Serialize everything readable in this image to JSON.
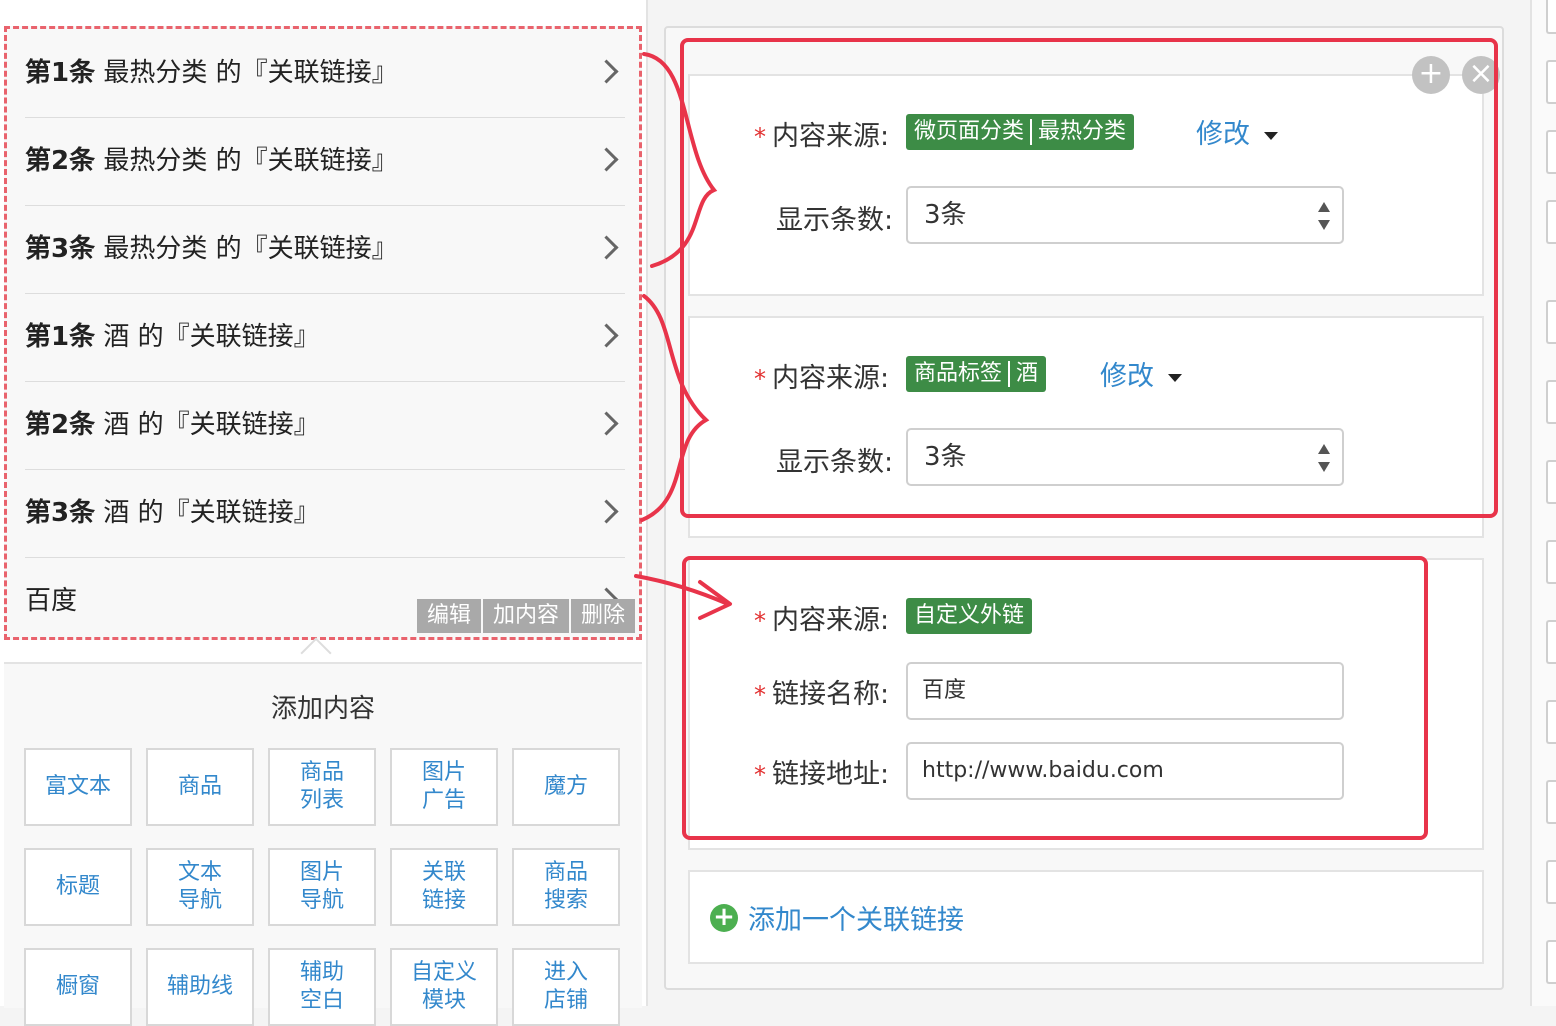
{
  "preview": {
    "rows": [
      {
        "num": "第1条",
        "text": " 最热分类 的『关联链接』"
      },
      {
        "num": "第2条",
        "text": " 最热分类 的『关联链接』"
      },
      {
        "num": "第3条",
        "text": " 最热分类 的『关联链接』"
      },
      {
        "num": "第1条",
        "text": " 酒 的『关联链接』"
      },
      {
        "num": "第2条",
        "text": " 酒 的『关联链接』"
      },
      {
        "num": "第3条",
        "text": " 酒 的『关联链接』"
      },
      {
        "num": "",
        "text": "百度"
      }
    ],
    "actions": [
      "编辑",
      "加内容",
      "删除"
    ]
  },
  "add_content": {
    "title": "添加内容",
    "buttons": [
      "富文本",
      "商品",
      "商品\n列表",
      "图片\n广告",
      "魔方",
      "标题",
      "文本\n导航",
      "图片\n导航",
      "关联\n链接",
      "商品\n搜索",
      "橱窗",
      "辅助线",
      "辅助\n空白",
      "自定义\n模块",
      "进入\n店铺"
    ]
  },
  "editor": {
    "controls": {
      "add": "+",
      "close": "×"
    },
    "sections": [
      {
        "source_label": "内容来源:",
        "source_tag_parts": [
          "微页面分类",
          "最热分类"
        ],
        "modify_label": "修改",
        "count_label": "显示条数:",
        "count_value": "3条"
      },
      {
        "source_label": "内容来源:",
        "source_tag_parts": [
          "商品标签",
          "酒"
        ],
        "modify_label": "修改",
        "count_label": "显示条数:",
        "count_value": "3条"
      },
      {
        "source_label": "内容来源:",
        "source_tag_parts": [
          "自定义外链"
        ],
        "name_label": "链接名称:",
        "name_value": "百度",
        "url_label": "链接地址:",
        "url_value": "http://www.baidu.com"
      }
    ],
    "add_link_label": "添加一个关联链接"
  },
  "colors": {
    "tag_green": "#3d8c46",
    "link_blue": "#3388cc",
    "annotation_red": "#e8344a",
    "required_red": "#e23030"
  }
}
